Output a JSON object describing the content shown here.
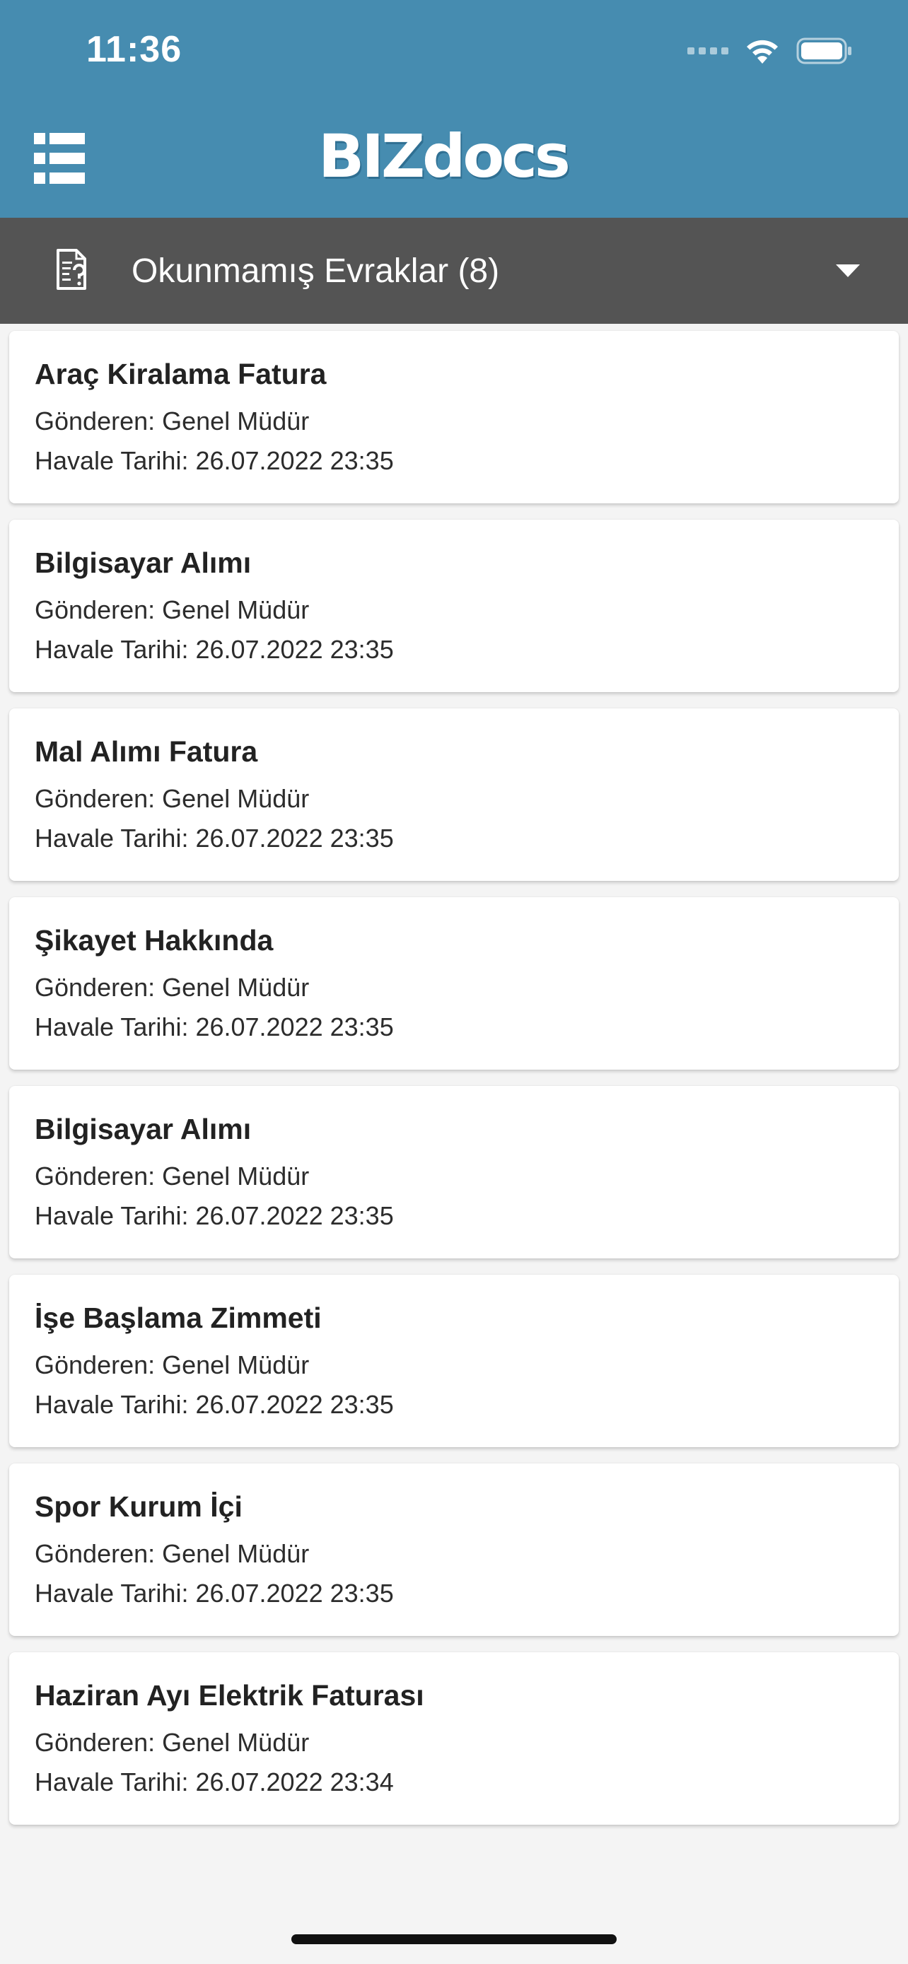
{
  "status_bar": {
    "time": "11:36"
  },
  "header": {
    "logo": "BIZdocs",
    "menu_icon": "list-menu-icon"
  },
  "filter": {
    "label": "Okunmamış Evraklar (8)",
    "icon": "document-question-icon",
    "caret": "caret-down-icon"
  },
  "documents": [
    {
      "title": "Araç Kiralama Fatura",
      "sender": "Gönderen: Genel Müdür",
      "date": "Havale Tarihi: 26.07.2022 23:35"
    },
    {
      "title": "Bilgisayar Alımı",
      "sender": "Gönderen: Genel Müdür",
      "date": "Havale Tarihi: 26.07.2022 23:35"
    },
    {
      "title": "Mal Alımı Fatura",
      "sender": "Gönderen: Genel Müdür",
      "date": "Havale Tarihi: 26.07.2022 23:35"
    },
    {
      "title": "Şikayet Hakkında",
      "sender": "Gönderen: Genel Müdür",
      "date": "Havale Tarihi: 26.07.2022 23:35"
    },
    {
      "title": "Bilgisayar Alımı",
      "sender": "Gönderen: Genel Müdür",
      "date": "Havale Tarihi: 26.07.2022 23:35"
    },
    {
      "title": "İşe Başlama Zimmeti",
      "sender": "Gönderen: Genel Müdür",
      "date": "Havale Tarihi: 26.07.2022 23:35"
    },
    {
      "title": "Spor Kurum İçi",
      "sender": "Gönderen: Genel Müdür",
      "date": "Havale Tarihi: 26.07.2022 23:35"
    },
    {
      "title": "Haziran Ayı Elektrik Faturası",
      "sender": "Gönderen: Genel Müdür",
      "date": "Havale Tarihi: 26.07.2022 23:34"
    }
  ],
  "colors": {
    "header": "#468cb0",
    "filter_bar": "#545454",
    "background": "#f4f4f4",
    "card": "#ffffff"
  }
}
